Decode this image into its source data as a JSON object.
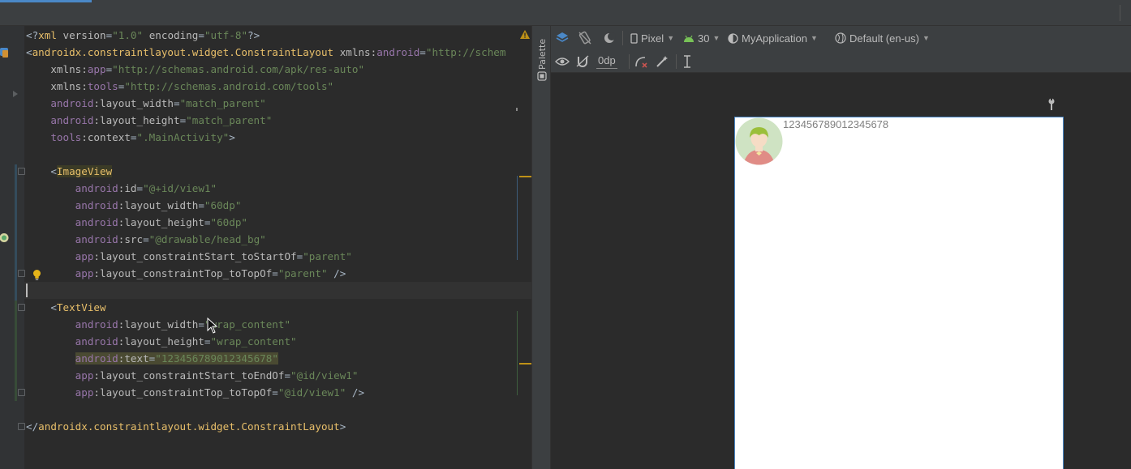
{
  "editor": {
    "lines": [
      {
        "tokens": [
          [
            "punc",
            "<?"
          ],
          [
            "tag",
            "xml "
          ],
          [
            "attr",
            "version"
          ],
          [
            "punc",
            "="
          ],
          [
            "val",
            "\"1.0\""
          ],
          [
            "attr",
            " encoding"
          ],
          [
            "punc",
            "="
          ],
          [
            "val",
            "\"utf-8\""
          ],
          [
            "punc",
            "?>"
          ]
        ]
      },
      {
        "tokens": [
          [
            "punc",
            "<"
          ],
          [
            "tag",
            "androidx.constraintlayout.widget.ConstraintLayout "
          ],
          [
            "attr",
            "xmlns:"
          ],
          [
            "ns",
            "android"
          ],
          [
            "punc",
            "="
          ],
          [
            "val",
            "\"http://schem"
          ]
        ]
      },
      {
        "tokens": [
          [
            "attr",
            "    xmlns:"
          ],
          [
            "ns",
            "app"
          ],
          [
            "punc",
            "="
          ],
          [
            "val",
            "\"http://schemas.android.com/apk/res-auto\""
          ]
        ]
      },
      {
        "tokens": [
          [
            "attr",
            "    xmlns:"
          ],
          [
            "ns",
            "tools"
          ],
          [
            "punc",
            "="
          ],
          [
            "val",
            "\"http://schemas.android.com/tools\""
          ]
        ]
      },
      {
        "tokens": [
          [
            "ns",
            "    android"
          ],
          [
            "attr",
            ":layout_width"
          ],
          [
            "punc",
            "="
          ],
          [
            "val",
            "\"match_parent\""
          ]
        ]
      },
      {
        "tokens": [
          [
            "ns",
            "    android"
          ],
          [
            "attr",
            ":layout_height"
          ],
          [
            "punc",
            "="
          ],
          [
            "val",
            "\"match_parent\""
          ]
        ]
      },
      {
        "tokens": [
          [
            "ns",
            "    tools"
          ],
          [
            "attr",
            ":context"
          ],
          [
            "punc",
            "="
          ],
          [
            "val",
            "\".MainActivity\""
          ],
          [
            "punc",
            ">"
          ]
        ]
      },
      {
        "tokens": []
      },
      {
        "tokens": [
          [
            "punc",
            "    <"
          ],
          [
            "hltag",
            "ImageView"
          ]
        ]
      },
      {
        "tokens": [
          [
            "ns",
            "        android"
          ],
          [
            "attr",
            ":id"
          ],
          [
            "punc",
            "="
          ],
          [
            "val",
            "\"@+id/view1\""
          ]
        ]
      },
      {
        "tokens": [
          [
            "ns",
            "        android"
          ],
          [
            "attr",
            ":layout_width"
          ],
          [
            "punc",
            "="
          ],
          [
            "val",
            "\"60dp\""
          ]
        ]
      },
      {
        "tokens": [
          [
            "ns",
            "        android"
          ],
          [
            "attr",
            ":layout_height"
          ],
          [
            "punc",
            "="
          ],
          [
            "val",
            "\"60dp\""
          ]
        ]
      },
      {
        "tokens": [
          [
            "ns",
            "        android"
          ],
          [
            "attr",
            ":src"
          ],
          [
            "punc",
            "="
          ],
          [
            "val",
            "\"@drawable/head_bg\""
          ]
        ]
      },
      {
        "tokens": [
          [
            "ns",
            "        app"
          ],
          [
            "attr",
            ":layout_constraintStart_toStartOf"
          ],
          [
            "punc",
            "="
          ],
          [
            "val",
            "\"parent\""
          ]
        ]
      },
      {
        "tokens": [
          [
            "ns",
            "        app"
          ],
          [
            "attr",
            ":layout_constraintTop_toTopOf"
          ],
          [
            "punc",
            "="
          ],
          [
            "val",
            "\"parent\""
          ],
          [
            "punc",
            " />"
          ]
        ]
      },
      {
        "tokens": []
      },
      {
        "tokens": [
          [
            "punc",
            "    <"
          ],
          [
            "tag",
            "TextView"
          ]
        ]
      },
      {
        "tokens": [
          [
            "ns",
            "        android"
          ],
          [
            "attr",
            ":layout_width"
          ],
          [
            "punc",
            "="
          ],
          [
            "val",
            "\"wrap_content\""
          ]
        ]
      },
      {
        "tokens": [
          [
            "ns",
            "        android"
          ],
          [
            "attr",
            ":layout_height"
          ],
          [
            "punc",
            "="
          ],
          [
            "val",
            "\"wrap_content\""
          ]
        ]
      },
      {
        "tokens": [
          [
            "pad",
            "        "
          ],
          [
            "hlns",
            "android"
          ],
          [
            "hlattr",
            ":text"
          ],
          [
            "hlpunc",
            "="
          ],
          [
            "hlval",
            "\"123456789012345678\""
          ]
        ]
      },
      {
        "tokens": [
          [
            "ns",
            "        app"
          ],
          [
            "attr",
            ":layout_constraintStart_toEndOf"
          ],
          [
            "punc",
            "="
          ],
          [
            "val",
            "\"@id/view1\""
          ]
        ]
      },
      {
        "tokens": [
          [
            "ns",
            "        app"
          ],
          [
            "attr",
            ":layout_constraintTop_toTopOf"
          ],
          [
            "punc",
            "="
          ],
          [
            "val",
            "\"@id/view1\""
          ],
          [
            "punc",
            " />"
          ]
        ]
      },
      {
        "tokens": []
      },
      {
        "tokens": [
          [
            "punc",
            "</"
          ],
          [
            "tag",
            "androidx.constraintlayout.widget.ConstraintLayout"
          ],
          [
            "punc",
            ">"
          ]
        ]
      }
    ]
  },
  "palette": {
    "label": "Palette"
  },
  "toolbar": {
    "device_label": "Pixel",
    "api_label": "30",
    "theme_label": "MyApplication",
    "locale_label": "Default (en-us)",
    "margin_label": "0dp"
  },
  "preview": {
    "text": "123456789012345678"
  },
  "icons": [
    "warning-icon",
    "bulb-icon",
    "run-icon",
    "layout-icon",
    "layers-icon",
    "orientation-icon",
    "night-mode-icon",
    "phone-icon",
    "android-icon",
    "theme-icon",
    "globe-icon",
    "eye-icon",
    "magnet-icon",
    "constraints-icon",
    "magic-wand-icon",
    "guidelines-icon",
    "wrench-icon",
    "avatar-image"
  ],
  "colors": {
    "accent": "#4a88c7",
    "tag": "#e8bf6a",
    "value": "#6a8759",
    "namespace": "#9876aa",
    "warning": "#be9117"
  }
}
